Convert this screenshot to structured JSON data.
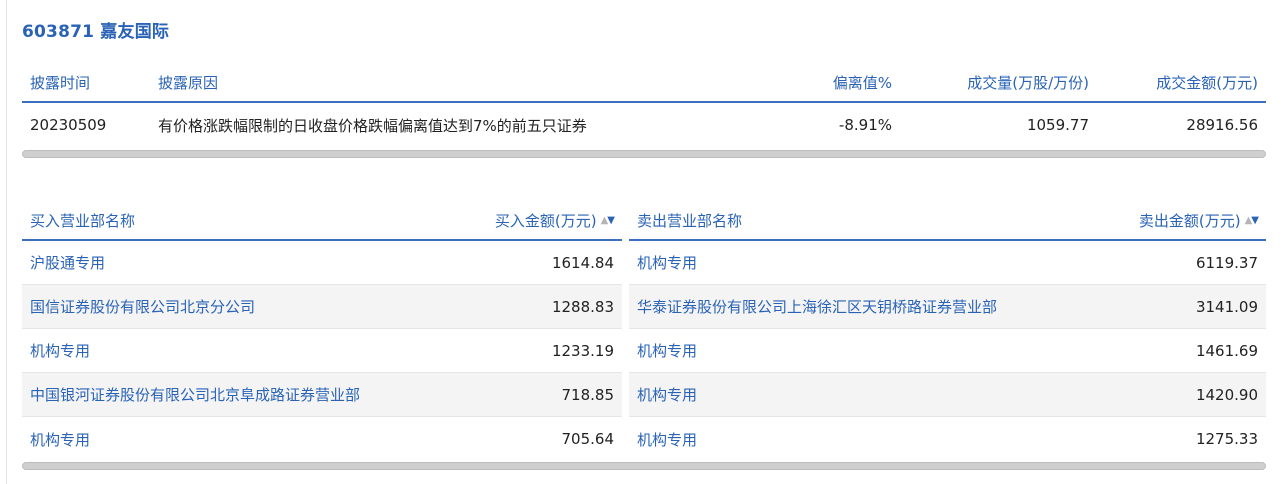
{
  "stock": {
    "title": "603871 嘉友国际"
  },
  "disclosure": {
    "headers": {
      "date": "披露时间",
      "reason": "披露原因",
      "deviation": "偏离值%",
      "volume": "成交量(万股/万份)",
      "amount": "成交金额(万元)"
    },
    "rows": [
      {
        "date": "20230509",
        "reason": "有价格涨跌幅限制的日收盘价格跌幅偏离值达到7%的前五只证券",
        "deviation": "-8.91%",
        "volume": "1059.77",
        "amount": "28916.56"
      }
    ]
  },
  "buy": {
    "headers": {
      "name": "买入营业部名称",
      "amount": "买入金额(万元)"
    },
    "rows": [
      {
        "name": "沪股通专用",
        "amount": "1614.84"
      },
      {
        "name": "国信证券股份有限公司北京分公司",
        "amount": "1288.83"
      },
      {
        "name": "机构专用",
        "amount": "1233.19"
      },
      {
        "name": "中国银河证券股份有限公司北京阜成路证券营业部",
        "amount": "718.85"
      },
      {
        "name": "机构专用",
        "amount": "705.64"
      }
    ]
  },
  "sell": {
    "headers": {
      "name": "卖出营业部名称",
      "amount": "卖出金额(万元)"
    },
    "rows": [
      {
        "name": "机构专用",
        "amount": "6119.37"
      },
      {
        "name": "华泰证券股份有限公司上海徐汇区天钥桥路证券营业部",
        "amount": "3141.09"
      },
      {
        "name": "机构专用",
        "amount": "1461.69"
      },
      {
        "name": "机构专用",
        "amount": "1420.90"
      },
      {
        "name": "机构专用",
        "amount": "1275.33"
      }
    ]
  },
  "icons": {
    "sort": "sort-icon"
  },
  "colors": {
    "accent": "#2a63b6",
    "rule": "#3b6fc0",
    "alt_row": "#f4f4f4"
  }
}
